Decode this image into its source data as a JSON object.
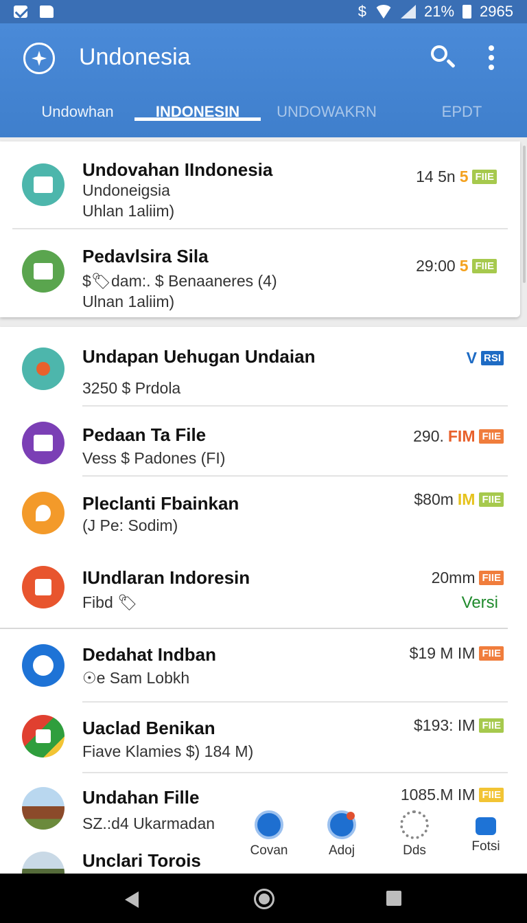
{
  "status_bar": {
    "left_icons": [
      "mail-icon",
      "document-icon"
    ],
    "currency_symbol": "$",
    "battery_percent": "21%",
    "time": "2965"
  },
  "app_bar": {
    "title": "Undonesia",
    "logo_icon": "compass-logo-icon",
    "search_icon": "search-icon",
    "menu_icon": "more-vertical-icon",
    "background_color": "#4285d8"
  },
  "tabs": [
    {
      "label": "Undowhan",
      "active": false
    },
    {
      "label": "INDONESIN",
      "active": true
    },
    {
      "label": "UNDOWAKRN",
      "active": false
    },
    {
      "label": "EPDT",
      "active": false
    }
  ],
  "card_one": {
    "items": [
      {
        "title": "Undovahan IIndonesia",
        "line2": "Undoneigsia",
        "line3": "Uhlan 1aliim)",
        "meta": "14 5n",
        "accent": "5",
        "badge": "FIIE",
        "icon": "house-icon",
        "icon_color": "#4db6ac",
        "accent_color": "#f4a21f",
        "badge_color": "#a6c94d"
      },
      {
        "title": "Pedavlsira Sila",
        "line2": "$🏷dam:. $ Benaaneres (4)",
        "line3": "Ulnan 1aliim)",
        "meta": "29:00",
        "accent": "5",
        "badge": "FIIE",
        "icon": "puzzle-icon",
        "icon_color": "#5aa54e",
        "accent_color": "#f4a21f",
        "badge_color": "#a6c94d"
      }
    ]
  },
  "card_two": {
    "items": [
      {
        "title": "Undapan Uehugan Undaian",
        "line2": "3250 $ Prdola",
        "meta": "V",
        "badge": "RSI",
        "icon": "location-icon",
        "icon_color": "#4db6ac",
        "accent_color": "#1e6bc4",
        "badge_color": "#1e6bc4"
      },
      {
        "title": "Pedaan Ta File",
        "line2": "Vess $ Padones (FI)",
        "meta": "290.",
        "accent": "FIM",
        "badge": "FIIE",
        "icon": "calendar-icon",
        "icon_color": "#7b3fb5",
        "accent_color": "#e8612c",
        "badge_color": "#f07d3c"
      },
      {
        "title": "Pleclanti Fbainkan",
        "line2": "(J Pe: Sodim)",
        "meta": "$80m",
        "accent": "IM",
        "badge": "FIIE",
        "icon": "rocket-icon",
        "icon_color": "#f39a2a",
        "accent_color": "#e6c21c",
        "badge_color": "#a6c94d"
      },
      {
        "title": "IUndlaran Indoresin",
        "line2": "Fibd 🏷",
        "meta": "20mm",
        "badge": "FIIE",
        "extra": "Versi",
        "icon": "bookmark-icon",
        "icon_color": "#e8552e",
        "badge_color": "#f07d3c",
        "extra_color": "#1f8a2c"
      },
      {
        "title": "Dedahat Indban",
        "line2": "☉e Sam Lobkh",
        "meta": "$19 M IM",
        "badge": "FIIE",
        "icon": "chat-icon",
        "icon_color": "#1e73d6",
        "badge_color": "#f07d3c"
      },
      {
        "title": "Uaclad Benikan",
        "line2": "Fiave Klamies $) 184 M)",
        "meta": "$193: IM",
        "badge": "FIIE",
        "icon": "image-icon",
        "icon_color": "#2f9e3d",
        "badge_color": "#a6c94d"
      },
      {
        "title": "Undahan Fille",
        "line2": "SZ.:d4 Ukarmadan",
        "meta": "1085.M IM",
        "badge": "FIIE",
        "icon": "photo-temple-icon",
        "icon_color": "#7a5a3a",
        "badge_color": "#f2c434"
      },
      {
        "title": "Unclari Torois",
        "line2": "",
        "meta": "",
        "icon": "photo-landscape-icon",
        "icon_color": "#556b3a"
      }
    ]
  },
  "bottom_nav": [
    {
      "label": "Covan",
      "icon": "home-icon",
      "color": "#1e6fd0"
    },
    {
      "label": "Adoj",
      "icon": "notification-icon",
      "color": "#1e6fd0"
    },
    {
      "label": "Dds",
      "icon": "gear-icon",
      "color": "#888888"
    },
    {
      "label": "Fotsi",
      "icon": "briefcase-icon",
      "color": "#1e73d6"
    }
  ],
  "system_nav": [
    "back-icon",
    "home-circle-icon",
    "recents-icon"
  ]
}
